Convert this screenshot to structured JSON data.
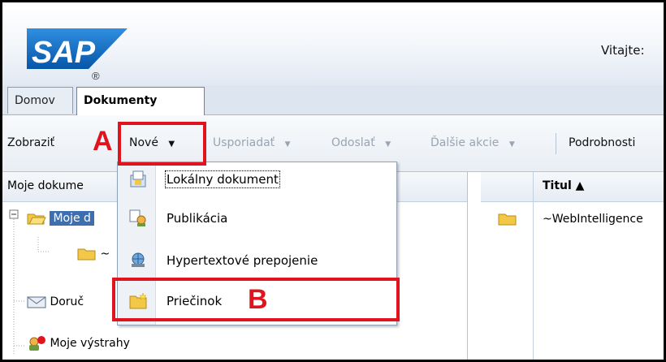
{
  "header": {
    "logo_text": "SAP",
    "logo_mark": "®",
    "welcome": "Vitajte:"
  },
  "tabs": [
    {
      "label": "Domov"
    },
    {
      "label": "Dokumenty"
    }
  ],
  "toolbar": {
    "view_label": "Zobraziť",
    "new_label": "Nové",
    "organize_label": "Usporiadať",
    "send_label": "Odoslať",
    "more_label": "Ďalšie akcie",
    "details_label": "Podrobnosti"
  },
  "left_pane": {
    "header": "Moje dokume",
    "tree": [
      {
        "label": "Moje d"
      },
      {
        "label": "~"
      },
      {
        "label": "Doruč"
      },
      {
        "label": "Moje výstrahy"
      }
    ]
  },
  "right_pane": {
    "column_title": "Titul ▲",
    "rows": [
      {
        "title": "~WebIntelligence"
      }
    ]
  },
  "new_menu": {
    "items": [
      {
        "label": "Lokálny dokument",
        "icon": "local-document-icon"
      },
      {
        "label": "Publikácia",
        "icon": "publication-icon"
      },
      {
        "label": "Hypertextové prepojenie",
        "icon": "hyperlink-icon"
      },
      {
        "label": "Priečinok",
        "icon": "folder-new-icon"
      }
    ]
  },
  "annotations": {
    "a": "A",
    "b": "B"
  },
  "colors": {
    "annotation_red": "#e0141e",
    "sap_blue": "#0a5fb5",
    "selection_blue": "#3d6fb0"
  }
}
